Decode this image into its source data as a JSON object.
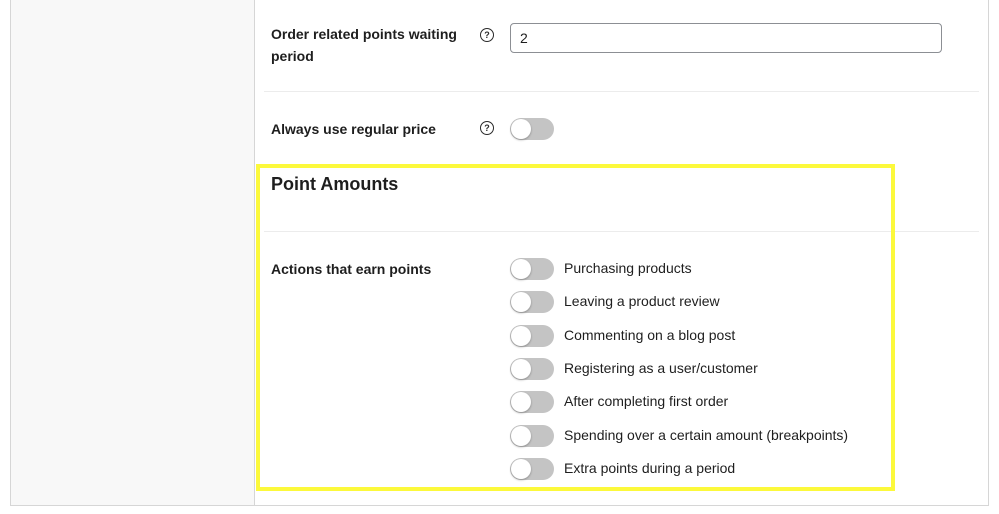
{
  "settings": {
    "waiting_period": {
      "label": "Order related points waiting period",
      "label_line1": "Order related points waiting",
      "label_line2": "period",
      "help_icon": "question-circle-icon",
      "value": "2"
    },
    "regular_price": {
      "label": "Always use regular price",
      "help_icon": "question-circle-icon",
      "enabled": false
    }
  },
  "point_amounts": {
    "title": "Point Amounts",
    "actions_label": "Actions that earn points",
    "actions": [
      {
        "label": "Purchasing products",
        "enabled": false
      },
      {
        "label": "Leaving a product review",
        "enabled": false
      },
      {
        "label": "Commenting on a blog post",
        "enabled": false
      },
      {
        "label": "Registering as a user/customer",
        "enabled": false
      },
      {
        "label": "After completing first order",
        "enabled": false
      },
      {
        "label": "Spending over a certain amount (breakpoints)",
        "enabled": false
      },
      {
        "label": "Extra points during a period",
        "enabled": false
      }
    ]
  },
  "colors": {
    "highlight": "#fcf93b",
    "toggle_off": "#c4c4c4"
  },
  "help_glyph": "?"
}
